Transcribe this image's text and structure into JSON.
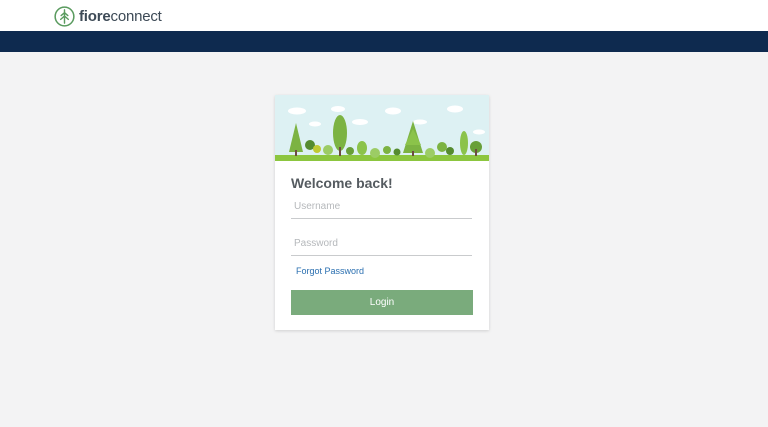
{
  "brand": {
    "name_bold": "fiore",
    "name_light": "connect",
    "icon": "tree-leaf-icon",
    "color": "#3d4a56"
  },
  "navbar": {
    "color": "#0e2a4f"
  },
  "login": {
    "heading": "Welcome back!",
    "username_placeholder": "Username",
    "username_value": "",
    "password_placeholder": "Password",
    "password_value": "",
    "forgot_label": "Forgot Password",
    "button_label": "Login",
    "button_color": "#7aab7c",
    "banner_icon": "forest-illustration"
  }
}
